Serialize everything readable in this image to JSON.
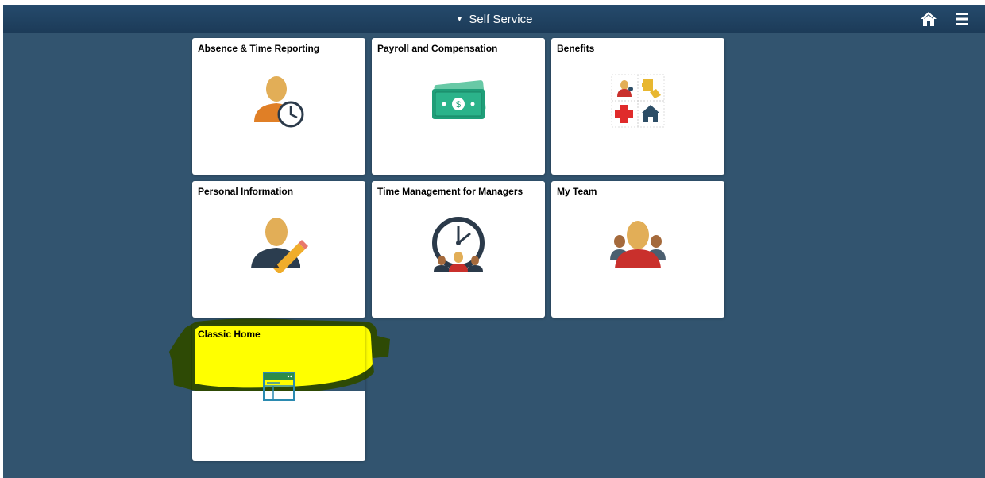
{
  "header": {
    "title": "Self Service",
    "caret": "▼"
  },
  "tiles": [
    {
      "title": "Absence & Time Reporting",
      "icon": "person-clock-icon"
    },
    {
      "title": "Payroll and Compensation",
      "icon": "money-icon"
    },
    {
      "title": "Benefits",
      "icon": "benefits-grid-icon"
    },
    {
      "title": "Personal Information",
      "icon": "person-pencil-icon"
    },
    {
      "title": "Time Management for Managers",
      "icon": "clock-team-icon"
    },
    {
      "title": "My Team",
      "icon": "team-icon"
    },
    {
      "title": "Classic Home",
      "icon": "window-icon"
    }
  ],
  "colors": {
    "background": "#32546f",
    "banner": "#1f4262",
    "highlight": "#ffff00"
  }
}
